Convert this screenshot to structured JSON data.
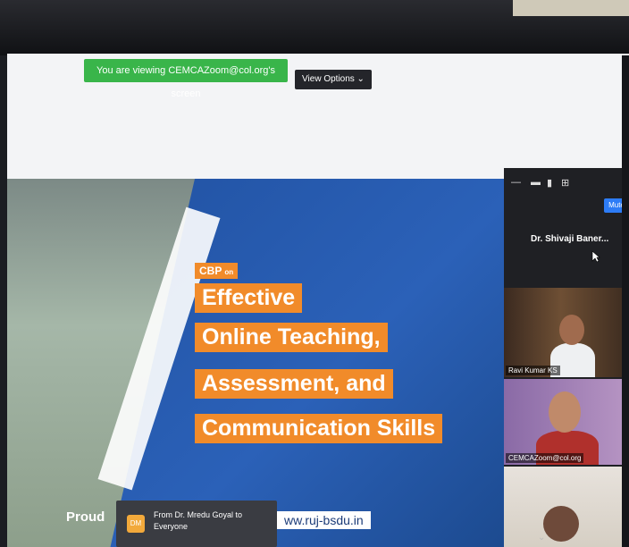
{
  "share_banner": {
    "text": "You are viewing CEMCAZoom@col.org's screen"
  },
  "view_options": {
    "label": "View Options ⌄"
  },
  "slide": {
    "cbp_logo": "CBP",
    "cbp_on": "on",
    "line1": "Effective",
    "line2": "Online Teaching,",
    "line3": "Assessment, and",
    "line4": "Communication Skills",
    "footer_left": "Proud",
    "website": "ww.ruj-bsdu.in"
  },
  "chat": {
    "avatar_initials": "DM",
    "line1": "From Dr. Mredu Goyal to",
    "line2": "Everyone"
  },
  "panel": {
    "mute_label": "Mute",
    "speaker_name": "Dr. Shivaji Baner...",
    "tiles": [
      {
        "name": "Ravi Kumar KS"
      },
      {
        "name": "CEMCAZoom@col.org"
      },
      {
        "name": ""
      }
    ]
  },
  "colors": {
    "accent_green": "#39b54a",
    "slide_orange": "#f18b2a",
    "slide_blue": "#2b61b8",
    "zoom_blue": "#2d7cf6"
  }
}
